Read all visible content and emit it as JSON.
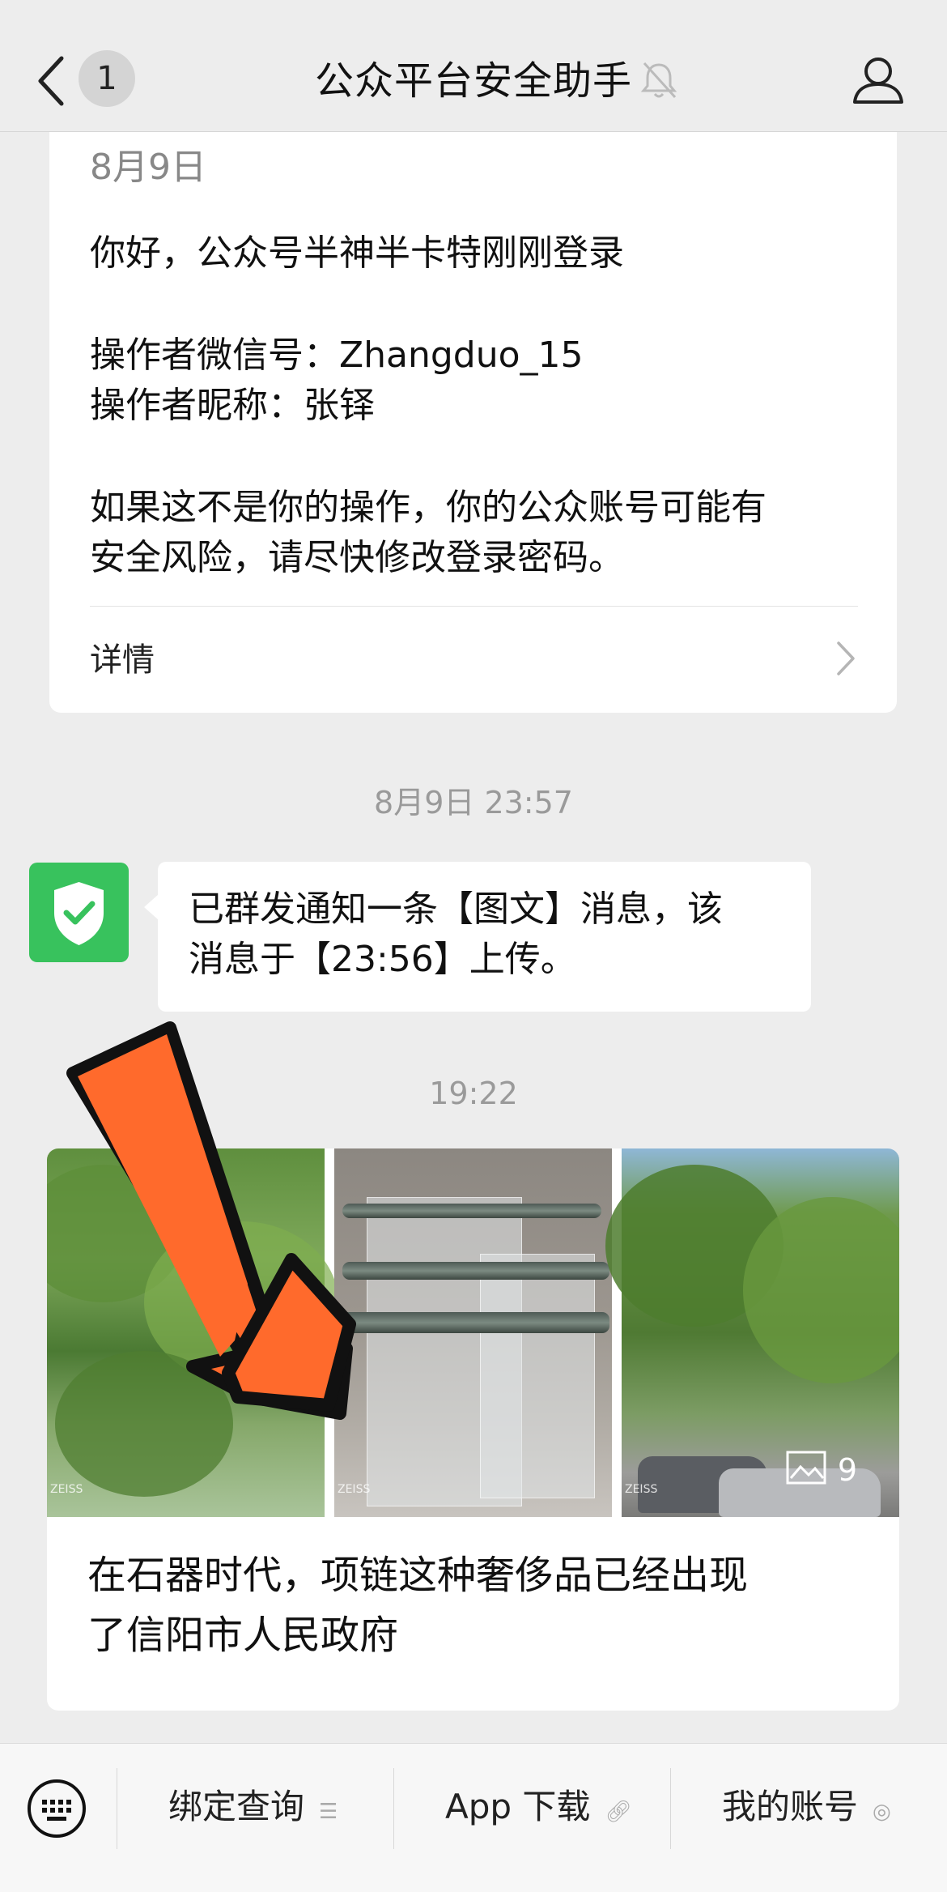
{
  "nav": {
    "back_count": "1",
    "title": "公众平台安全助手"
  },
  "notice_card": {
    "date": "8月9日",
    "greeting": "你好，公众号半神半卡特刚刚登录",
    "operator_id_line": "操作者微信号：Zhangduo_15",
    "operator_nick_line": "操作者昵称：张铎",
    "warning_line1": "如果这不是你的操作，你的公众账号可能有",
    "warning_line2": "安全风险，请尽快修改登录密码。",
    "detail_label": "详情"
  },
  "timestamp1": "8月9日 23:57",
  "message": {
    "line1": "已群发通知一条【图文】消息，该",
    "line2": "消息于【23:56】上传。"
  },
  "timestamp2": "19:22",
  "article": {
    "image_count": "9",
    "title_line1": "在石器时代，项链这种奢侈品已经出现",
    "title_line2": "了信阳市人民政府"
  },
  "bottom_menu": {
    "items": [
      {
        "label": "绑定查询"
      },
      {
        "label": "App 下载"
      },
      {
        "label": "我的账号"
      }
    ]
  },
  "colors": {
    "background": "#ededed",
    "avatar_green": "#38c25d",
    "arrow_orange": "#ff6a2c"
  }
}
